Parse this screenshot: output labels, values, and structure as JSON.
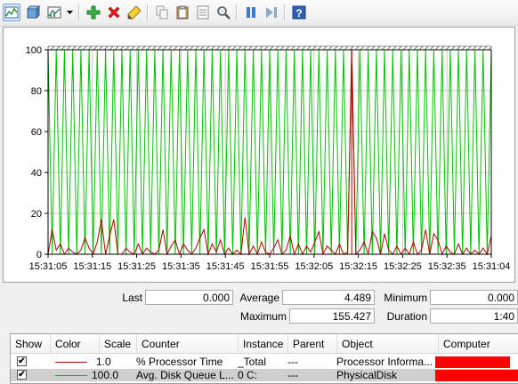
{
  "toolbar": {
    "buttons": [
      {
        "name": "view-graph-icon",
        "active": true
      },
      {
        "name": "view-histogram-icon"
      },
      {
        "name": "change-graph-type-icon"
      },
      {
        "name": "add-counter-icon"
      },
      {
        "name": "delete-counter-icon"
      },
      {
        "name": "highlight-icon"
      },
      {
        "name": "copy-properties-icon"
      },
      {
        "name": "paste-counter-list-icon"
      },
      {
        "name": "properties-icon"
      },
      {
        "name": "zoom-icon"
      },
      {
        "name": "freeze-display-icon"
      },
      {
        "name": "update-data-icon"
      },
      {
        "name": "help-icon"
      }
    ]
  },
  "chart_data": {
    "type": "line",
    "ylim": [
      0,
      100
    ],
    "yticks": [
      "100",
      "80",
      "60",
      "40",
      "20",
      "0"
    ],
    "xticks": [
      "15:31:05",
      "15:31:15",
      "15:31:25",
      "15:31:35",
      "15:31:45",
      "15:31:55",
      "15:32:05",
      "15:32:15",
      "15:32:25",
      "15:32:35",
      "15:31:04"
    ],
    "grid": true,
    "time_marker_index": 74,
    "series": [
      {
        "counter": "% Processor Time",
        "color": "#b00000",
        "scale": 1.0,
        "values": [
          0,
          12,
          2,
          5,
          0,
          3,
          1,
          0,
          2,
          8,
          3,
          0,
          6,
          17,
          0,
          9,
          17,
          0,
          0,
          3,
          1,
          0,
          5,
          0,
          3,
          1,
          0,
          2,
          12,
          0,
          4,
          7,
          0,
          5,
          2,
          0,
          3,
          8,
          12,
          0,
          5,
          1,
          7,
          0,
          3,
          0,
          2,
          0,
          18,
          0,
          4,
          0,
          6,
          1,
          0,
          3,
          7,
          0,
          2,
          9,
          0,
          5,
          0,
          4,
          1,
          6,
          11,
          0,
          4,
          2,
          0,
          5,
          0,
          1,
          100,
          0,
          2,
          6,
          0,
          11,
          8,
          0,
          10,
          2,
          0,
          4,
          0,
          3,
          0,
          6,
          0,
          2,
          12,
          0,
          10,
          7,
          0,
          4,
          1,
          0,
          5,
          0,
          3,
          0,
          2,
          0,
          3,
          0,
          9
        ]
      },
      {
        "counter": "Avg. Disk Queue Length",
        "color": "#00c000",
        "scale": 100.0,
        "values": [
          100,
          0,
          100,
          0,
          100,
          0,
          100,
          0,
          100,
          0,
          100,
          0,
          100,
          0,
          100,
          0,
          100,
          0,
          100,
          0,
          100,
          0,
          100,
          0,
          100,
          0,
          100,
          0,
          100,
          0,
          100,
          0,
          100,
          0,
          100,
          0,
          100,
          0,
          100,
          0,
          100,
          0,
          100,
          0,
          100,
          0,
          100,
          0,
          100,
          0,
          100,
          0,
          100,
          0,
          100,
          0,
          100,
          0,
          100,
          0,
          100,
          0,
          100,
          0,
          100,
          0,
          100,
          0,
          100,
          0,
          100,
          0,
          100,
          0,
          100,
          0,
          100,
          0,
          100,
          0,
          100,
          0,
          100,
          0,
          100,
          0,
          100,
          0,
          100,
          0,
          100,
          0,
          100,
          0,
          100,
          0,
          100,
          0,
          100,
          0,
          100,
          0,
          100,
          0,
          100,
          0,
          100,
          0,
          100
        ]
      }
    ]
  },
  "stats": {
    "last_label": "Last",
    "last_value": "0.000",
    "average_label": "Average",
    "average_value": "4.489",
    "minimum_label": "Minimum",
    "minimum_value": "0.000",
    "maximum_label": "Maximum",
    "maximum_value": "155.427",
    "duration_label": "Duration",
    "duration_value": "1:40"
  },
  "table": {
    "columns": [
      "Show",
      "Color",
      "Scale",
      "Counter",
      "Instance",
      "Parent",
      "Object",
      "Computer"
    ],
    "rows": [
      {
        "show": "✔",
        "color": "#b00000",
        "scale": "1.0",
        "counter": "% Processor Time",
        "instance": "_Total",
        "parent": "---",
        "object": "Processor Informa..."
      },
      {
        "show": "✔",
        "color": "#00c000",
        "scale": "100.0",
        "counter": "Avg. Disk Queue L...",
        "instance": "0 C:",
        "parent": "---",
        "object": "PhysicalDisk"
      }
    ]
  }
}
